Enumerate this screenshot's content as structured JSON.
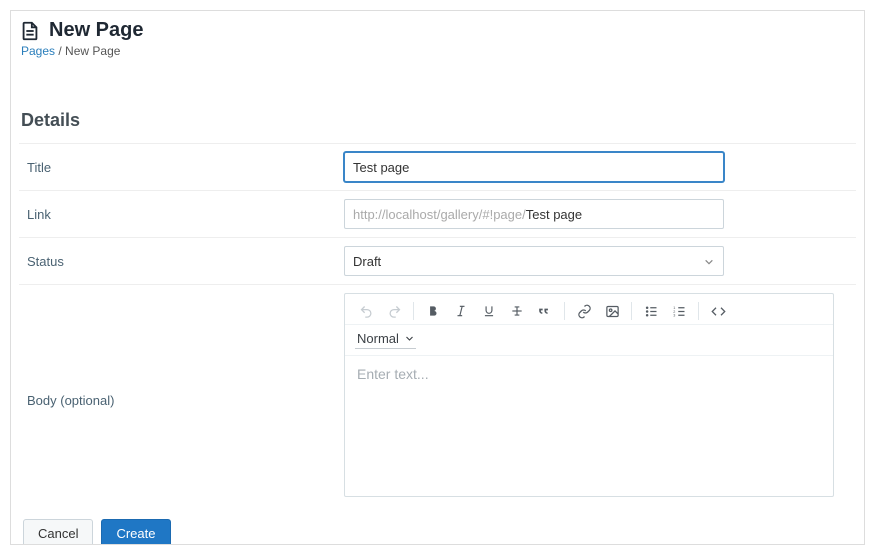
{
  "page": {
    "title": "New Page",
    "breadcrumb_root": "Pages",
    "breadcrumb_sep": " / ",
    "breadcrumb_current": "New Page"
  },
  "section_heading": "Details",
  "form": {
    "title_label": "Title",
    "title_value": "Test page",
    "link_label": "Link",
    "link_prefix": "http://localhost/gallery/#!page/",
    "link_value": "Test page",
    "status_label": "Status",
    "status_value": "Draft",
    "body_label": "Body (optional)"
  },
  "editor": {
    "format_value": "Normal",
    "placeholder": "Enter text..."
  },
  "actions": {
    "cancel": "Cancel",
    "create": "Create"
  }
}
